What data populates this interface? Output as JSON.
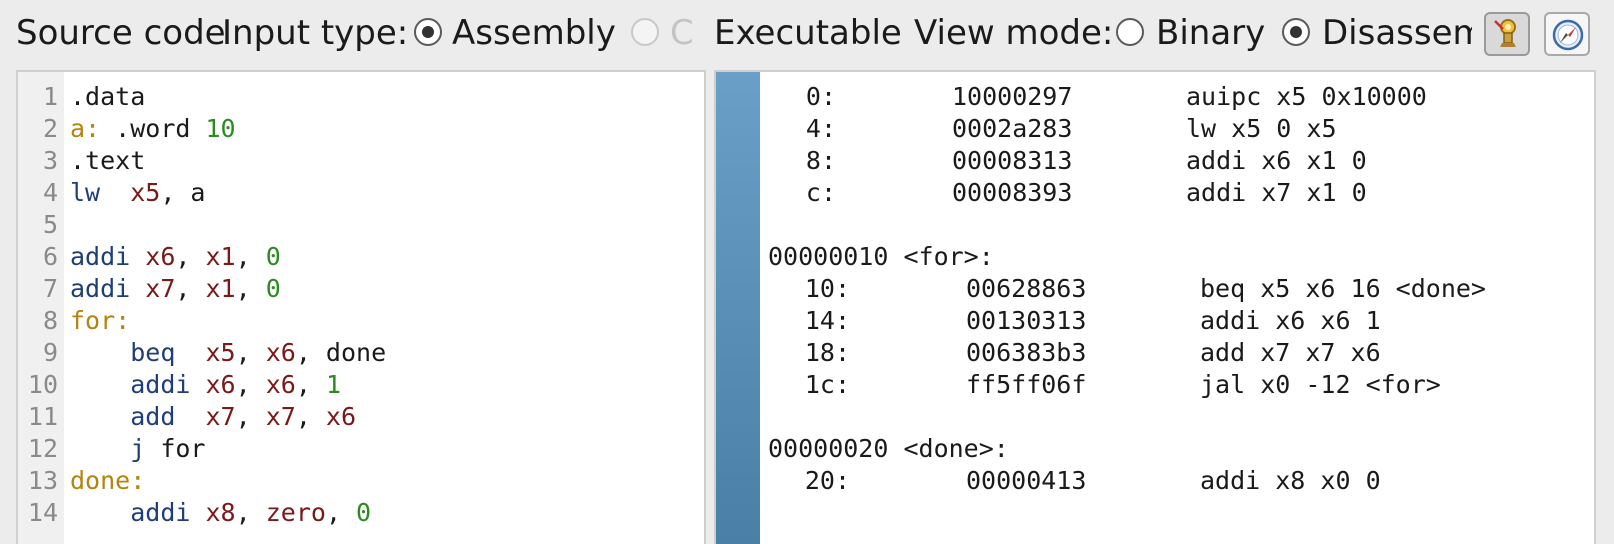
{
  "toolbar": {
    "source_code_label": "Source code",
    "input_type_label": "Input type:",
    "input_types": [
      {
        "label": "Assembly",
        "selected": true,
        "enabled": true
      },
      {
        "label": "C",
        "selected": false,
        "enabled": false
      },
      {
        "label": "Executable (",
        "selected": false,
        "enabled": true
      }
    ],
    "view_mode_label": "View mode:",
    "view_modes": [
      {
        "label": "Binary",
        "selected": false
      },
      {
        "label": "Disassembled",
        "selected": true
      }
    ],
    "icons": [
      "follow-program-counter-icon",
      "compass-icon"
    ]
  },
  "editor": {
    "lines": [
      {
        "n": "1",
        "tokens": [
          {
            "t": ".data",
            "k": "plain"
          }
        ]
      },
      {
        "n": "2",
        "tokens": [
          {
            "t": "a:",
            "k": "label"
          },
          {
            "t": " .word ",
            "k": "plain"
          },
          {
            "t": "10",
            "k": "num"
          }
        ]
      },
      {
        "n": "3",
        "tokens": [
          {
            "t": ".text",
            "k": "plain"
          }
        ]
      },
      {
        "n": "4",
        "tokens": [
          {
            "t": "lw",
            "k": "op"
          },
          {
            "t": "  ",
            "k": "plain"
          },
          {
            "t": "x5",
            "k": "reg"
          },
          {
            "t": ", a",
            "k": "plain"
          }
        ]
      },
      {
        "n": "5",
        "tokens": []
      },
      {
        "n": "6",
        "tokens": [
          {
            "t": "addi",
            "k": "op"
          },
          {
            "t": " ",
            "k": "plain"
          },
          {
            "t": "x6",
            "k": "reg"
          },
          {
            "t": ", ",
            "k": "plain"
          },
          {
            "t": "x1",
            "k": "reg"
          },
          {
            "t": ", ",
            "k": "plain"
          },
          {
            "t": "0",
            "k": "num"
          }
        ]
      },
      {
        "n": "7",
        "tokens": [
          {
            "t": "addi",
            "k": "op"
          },
          {
            "t": " ",
            "k": "plain"
          },
          {
            "t": "x7",
            "k": "reg"
          },
          {
            "t": ", ",
            "k": "plain"
          },
          {
            "t": "x1",
            "k": "reg"
          },
          {
            "t": ", ",
            "k": "plain"
          },
          {
            "t": "0",
            "k": "num"
          }
        ]
      },
      {
        "n": "8",
        "tokens": [
          {
            "t": "for:",
            "k": "label"
          }
        ]
      },
      {
        "n": "9",
        "tokens": [
          {
            "t": "    ",
            "k": "plain"
          },
          {
            "t": "beq",
            "k": "op"
          },
          {
            "t": "  ",
            "k": "plain"
          },
          {
            "t": "x5",
            "k": "reg"
          },
          {
            "t": ", ",
            "k": "plain"
          },
          {
            "t": "x6",
            "k": "reg"
          },
          {
            "t": ", done",
            "k": "plain"
          }
        ]
      },
      {
        "n": "10",
        "tokens": [
          {
            "t": "    ",
            "k": "plain"
          },
          {
            "t": "addi",
            "k": "op"
          },
          {
            "t": " ",
            "k": "plain"
          },
          {
            "t": "x6",
            "k": "reg"
          },
          {
            "t": ", ",
            "k": "plain"
          },
          {
            "t": "x6",
            "k": "reg"
          },
          {
            "t": ", ",
            "k": "plain"
          },
          {
            "t": "1",
            "k": "num"
          }
        ]
      },
      {
        "n": "11",
        "tokens": [
          {
            "t": "    ",
            "k": "plain"
          },
          {
            "t": "add",
            "k": "op"
          },
          {
            "t": "  ",
            "k": "plain"
          },
          {
            "t": "x7",
            "k": "reg"
          },
          {
            "t": ", ",
            "k": "plain"
          },
          {
            "t": "x7",
            "k": "reg"
          },
          {
            "t": ", ",
            "k": "plain"
          },
          {
            "t": "x6",
            "k": "reg"
          }
        ]
      },
      {
        "n": "12",
        "tokens": [
          {
            "t": "    ",
            "k": "plain"
          },
          {
            "t": "j",
            "k": "op"
          },
          {
            "t": " for",
            "k": "plain"
          }
        ]
      },
      {
        "n": "13",
        "tokens": [
          {
            "t": "done:",
            "k": "label"
          }
        ]
      },
      {
        "n": "14",
        "tokens": [
          {
            "t": "    ",
            "k": "plain"
          },
          {
            "t": "addi",
            "k": "op"
          },
          {
            "t": " ",
            "k": "plain"
          },
          {
            "t": "x8",
            "k": "reg"
          },
          {
            "t": ", ",
            "k": "plain"
          },
          {
            "t": "zero",
            "k": "reg"
          },
          {
            "t": ", ",
            "k": "plain"
          },
          {
            "t": "0",
            "k": "num"
          }
        ]
      }
    ]
  },
  "disassembly": {
    "lines": [
      {
        "kind": "instr",
        "addr": "0:",
        "hex": "10000297",
        "asm": "auipc x5 0x10000"
      },
      {
        "kind": "instr",
        "addr": "4:",
        "hex": "0002a283",
        "asm": "lw x5 0 x5"
      },
      {
        "kind": "instr",
        "addr": "8:",
        "hex": "00008313",
        "asm": "addi x6 x1 0"
      },
      {
        "kind": "instr",
        "addr": "c:",
        "hex": "00008393",
        "asm": "addi x7 x1 0"
      },
      {
        "kind": "blank"
      },
      {
        "kind": "label",
        "text": "00000010 <for>:"
      },
      {
        "kind": "instr2",
        "addr": "10:",
        "hex": "00628863",
        "asm": "beq x5 x6 16 <done>"
      },
      {
        "kind": "instr2",
        "addr": "14:",
        "hex": "00130313",
        "asm": "addi x6 x6 1"
      },
      {
        "kind": "instr2",
        "addr": "18:",
        "hex": "006383b3",
        "asm": "add x7 x7 x6"
      },
      {
        "kind": "instr2",
        "addr": "1c:",
        "hex": "ff5ff06f",
        "asm": "jal x0 -12 <for>"
      },
      {
        "kind": "blank"
      },
      {
        "kind": "label",
        "text": "00000020 <done>:"
      },
      {
        "kind": "instr2",
        "addr": "20:",
        "hex": "00000413",
        "asm": "addi x8 x0 0"
      }
    ]
  }
}
